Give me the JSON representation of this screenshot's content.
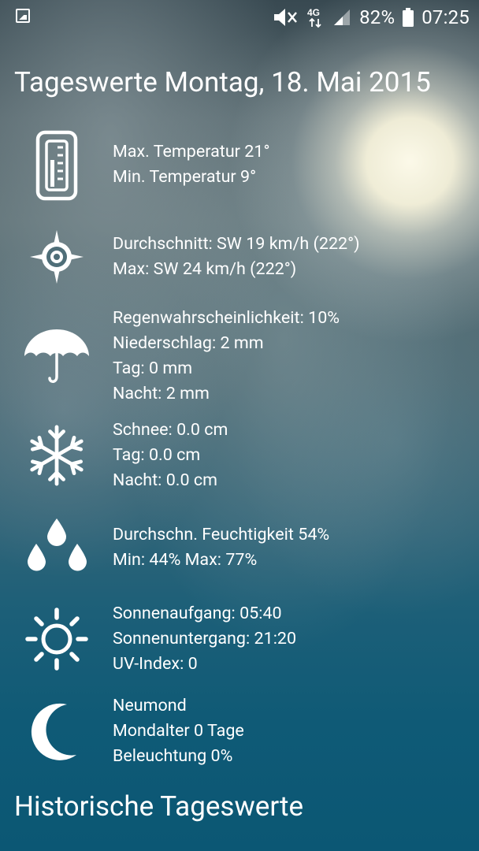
{
  "status_bar": {
    "battery": "82%",
    "time": "07:25",
    "network": "4G",
    "icons": [
      "gallery-icon",
      "mute-icon",
      "network-4g-icon",
      "signal-icon",
      "battery-icon"
    ]
  },
  "page": {
    "title": "Tageswerte Montag, 18. Mai 2015",
    "historical_title": "Historische Tageswerte"
  },
  "rows": [
    {
      "icon": "thermometer-icon",
      "lines": [
        "Max. Temperatur 21°",
        "Min. Temperatur 9°"
      ]
    },
    {
      "icon": "wind-compass-icon",
      "lines": [
        "Durchschnitt: SW 19 km/h (222°)",
        "Max: SW 24 km/h (222°)"
      ]
    },
    {
      "icon": "umbrella-icon",
      "lines": [
        "Regenwahrscheinlichkeit: 10%",
        "Niederschlag: 2 mm",
        "Tag: 0 mm",
        "Nacht: 2 mm"
      ]
    },
    {
      "icon": "snowflake-icon",
      "lines": [
        "Schnee: 0.0 cm",
        "Tag: 0.0 cm",
        "Nacht: 0.0 cm"
      ]
    },
    {
      "icon": "humidity-drops-icon",
      "lines": [
        "Durchschn. Feuchtigkeit 54%",
        "Min: 44% Max: 77%"
      ]
    },
    {
      "icon": "sun-icon",
      "lines": [
        "Sonnenaufgang: 05:40",
        "Sonnenuntergang: 21:20",
        "UV-Index: 0"
      ]
    },
    {
      "icon": "moon-icon",
      "lines": [
        "Neumond",
        "Mondalter 0 Tage",
        "Beleuchtung 0%"
      ]
    }
  ]
}
